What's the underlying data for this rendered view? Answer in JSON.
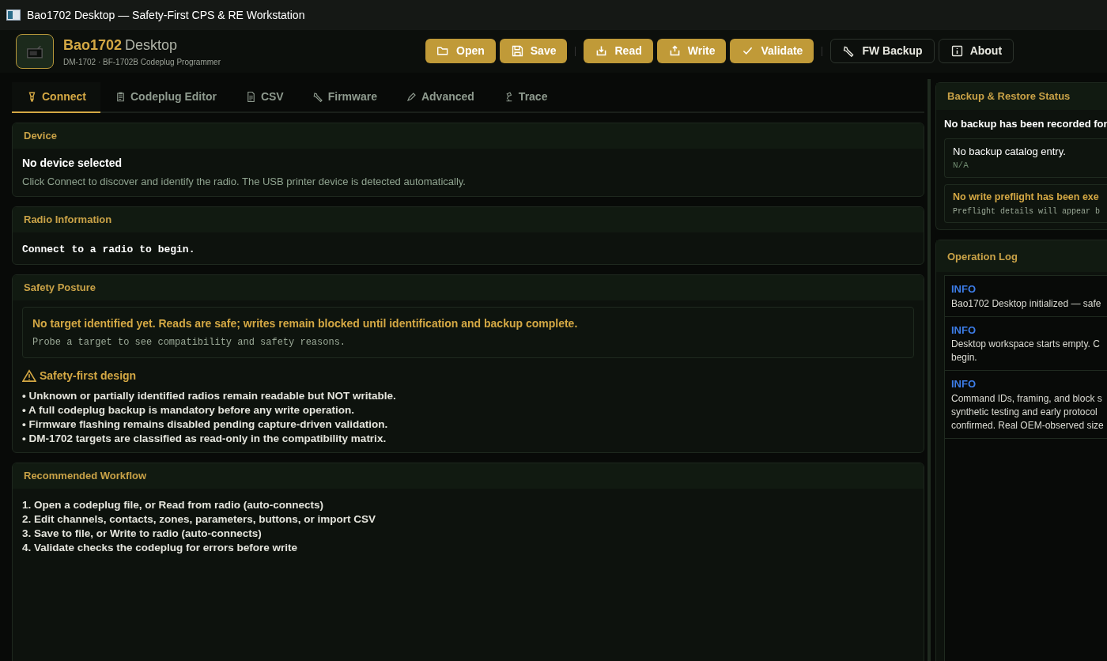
{
  "window": {
    "title": "Bao1702 Desktop — Safety-First CPS & RE Workstation"
  },
  "header": {
    "brand": "Bao1702",
    "brand_suffix": "Desktop",
    "subtitle": "DM-1702 · BF-1702B Codeplug Programmer"
  },
  "toolbar": [
    {
      "label": "Open",
      "kind": "primary"
    },
    {
      "label": "Save",
      "kind": "primary"
    },
    {
      "kind": "separator"
    },
    {
      "label": "Read",
      "kind": "primary"
    },
    {
      "label": "Write",
      "kind": "primary"
    },
    {
      "label": "Validate",
      "kind": "primary"
    },
    {
      "kind": "separator"
    },
    {
      "label": "FW Backup",
      "kind": "outline"
    },
    {
      "label": "About",
      "kind": "outline"
    }
  ],
  "tabs": [
    {
      "label": "Connect",
      "selected": true
    },
    {
      "label": "Codeplug Editor",
      "selected": false
    },
    {
      "label": "CSV",
      "selected": false
    },
    {
      "label": "Firmware",
      "selected": false
    },
    {
      "label": "Advanced",
      "selected": false
    },
    {
      "label": "Trace",
      "selected": false
    }
  ],
  "device": {
    "title": "Device",
    "status": "No device selected",
    "hint": "Click Connect to discover and identify the radio. The USB printer device is detected automatically."
  },
  "radio_info": {
    "title": "Radio Information",
    "text": "Connect to a radio to begin."
  },
  "safety": {
    "title": "Safety Posture",
    "alert": "No target identified yet. Reads are safe; writes remain blocked until identification and backup complete.",
    "alert_detail": "Probe a target to see compatibility and safety reasons.",
    "design_title": "Safety-first design",
    "points": [
      "• Unknown or partially identified radios remain readable but NOT writable.",
      "• A full codeplug backup is mandatory before any write operation.",
      "• Firmware flashing remains disabled pending capture-driven validation.",
      "• DM-1702 targets are classified as read-only in the compatibility matrix."
    ]
  },
  "workflow": {
    "title": "Recommended Workflow",
    "steps": [
      "1. Open a codeplug file, or Read from radio (auto-connects)",
      "2. Edit channels, contacts, zones, parameters, buttons, or import CSV",
      "3. Save to file, or Write to radio (auto-connects)",
      "4. Validate checks the codeplug for errors before write"
    ]
  },
  "backup": {
    "title": "Backup & Restore Status",
    "summary": "No backup has been recorded for",
    "catalog": "No backup catalog entry.",
    "catalog_detail": "N/A",
    "preflight": "No write preflight has been exe",
    "preflight_detail": "Preflight details will appear b"
  },
  "log": {
    "title": "Operation Log",
    "entries": [
      {
        "level": "INFO",
        "lines": [
          "Bao1702 Desktop initialized — safe"
        ]
      },
      {
        "level": "INFO",
        "lines": [
          "Desktop workspace starts empty. C",
          "begin."
        ]
      },
      {
        "level": "INFO",
        "lines": [
          "Command IDs, framing, and block s",
          "synthetic testing and early protocol",
          "confirmed. Real OEM-observed size"
        ]
      }
    ]
  }
}
